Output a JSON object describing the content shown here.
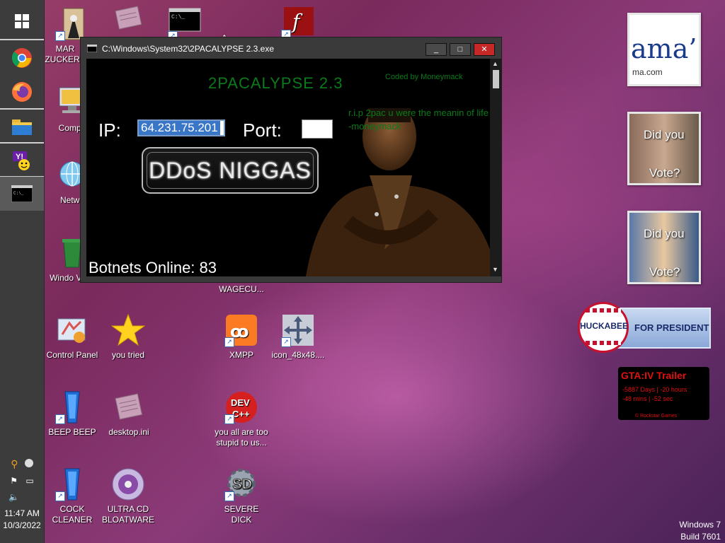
{
  "taskbar": {
    "pinned": [
      "Windows",
      "Chrome",
      "Firefox",
      "File Explorer",
      "Yahoo Messenger",
      "Command Prompt"
    ],
    "clock_time": "11:47 AM",
    "clock_date": "10/3/2022"
  },
  "desktop_icons": [
    {
      "label": "MAR ZUCKERB",
      "icon": "mark-zuckerberg-icon"
    },
    {
      "label": "Compu",
      "icon": "computer-icon"
    },
    {
      "label": "Netwo",
      "icon": "network-icon"
    },
    {
      "label": "Windo Vista",
      "icon": "recycle-bin-icon"
    },
    {
      "label": "Control Panel",
      "icon": "control-panel-icon"
    },
    {
      "label": "you tried",
      "icon": "star-icon"
    },
    {
      "label": "WAGECU...",
      "icon": "file-icon"
    },
    {
      "label": "XMPP",
      "icon": "xampp-icon"
    },
    {
      "label": "icon_48x48....",
      "icon": "move-arrows-icon"
    },
    {
      "label": "BEEP BEEP",
      "icon": "blue-app-icon"
    },
    {
      "label": "desktop.ini",
      "icon": "ini-file-icon"
    },
    {
      "label": "you all are too stupid to us...",
      "icon": "dev-cpp-icon"
    },
    {
      "label": "COCK CLEANER",
      "icon": "blue-app-icon"
    },
    {
      "label": "ULTRA CD BLOATWARE",
      "icon": "cd-icon"
    },
    {
      "label": "SEVERE DICK",
      "icon": "sd-gear-icon"
    }
  ],
  "window": {
    "title": "C:\\Windows\\System32\\2PACALYPSE 2.3.exe",
    "minimize": "_",
    "maximize": "□",
    "close": "✕",
    "app_title": "2PACALYPSE  2.3",
    "coded_by": "Coded by Moneymack",
    "rip_text": "r.i.p 2pac u were the meanin of life -moneymack",
    "ip_label": "IP:",
    "ip_value": "64.231.75.201",
    "port_label": "Port:",
    "port_value": "",
    "ddos_button": "DDoS NIGGAS",
    "botnets": "Botnets Online: 83"
  },
  "widgets": {
    "obama_text": "ama’",
    "obama_url": "ma.com",
    "did_you": "Did you",
    "vote": "Vote?",
    "huckabee_name": "HUCKABEE",
    "huckabee_for": "FOR PRESIDENT",
    "gta_title": "GTA:IV  Trailer",
    "gta_line1": "-5887 Days | -20 hours",
    "gta_line2": "-48 mins | -52 sec",
    "gta_footer": "© Rockstar Games"
  },
  "watermark": {
    "line1": "Windows 7",
    "line2": "Build 7601"
  },
  "colors": {
    "taskbar": "#3c3c3c",
    "terminal_green": "#0a7a1a",
    "close_red": "#c62828",
    "gta_red": "#e01010"
  }
}
